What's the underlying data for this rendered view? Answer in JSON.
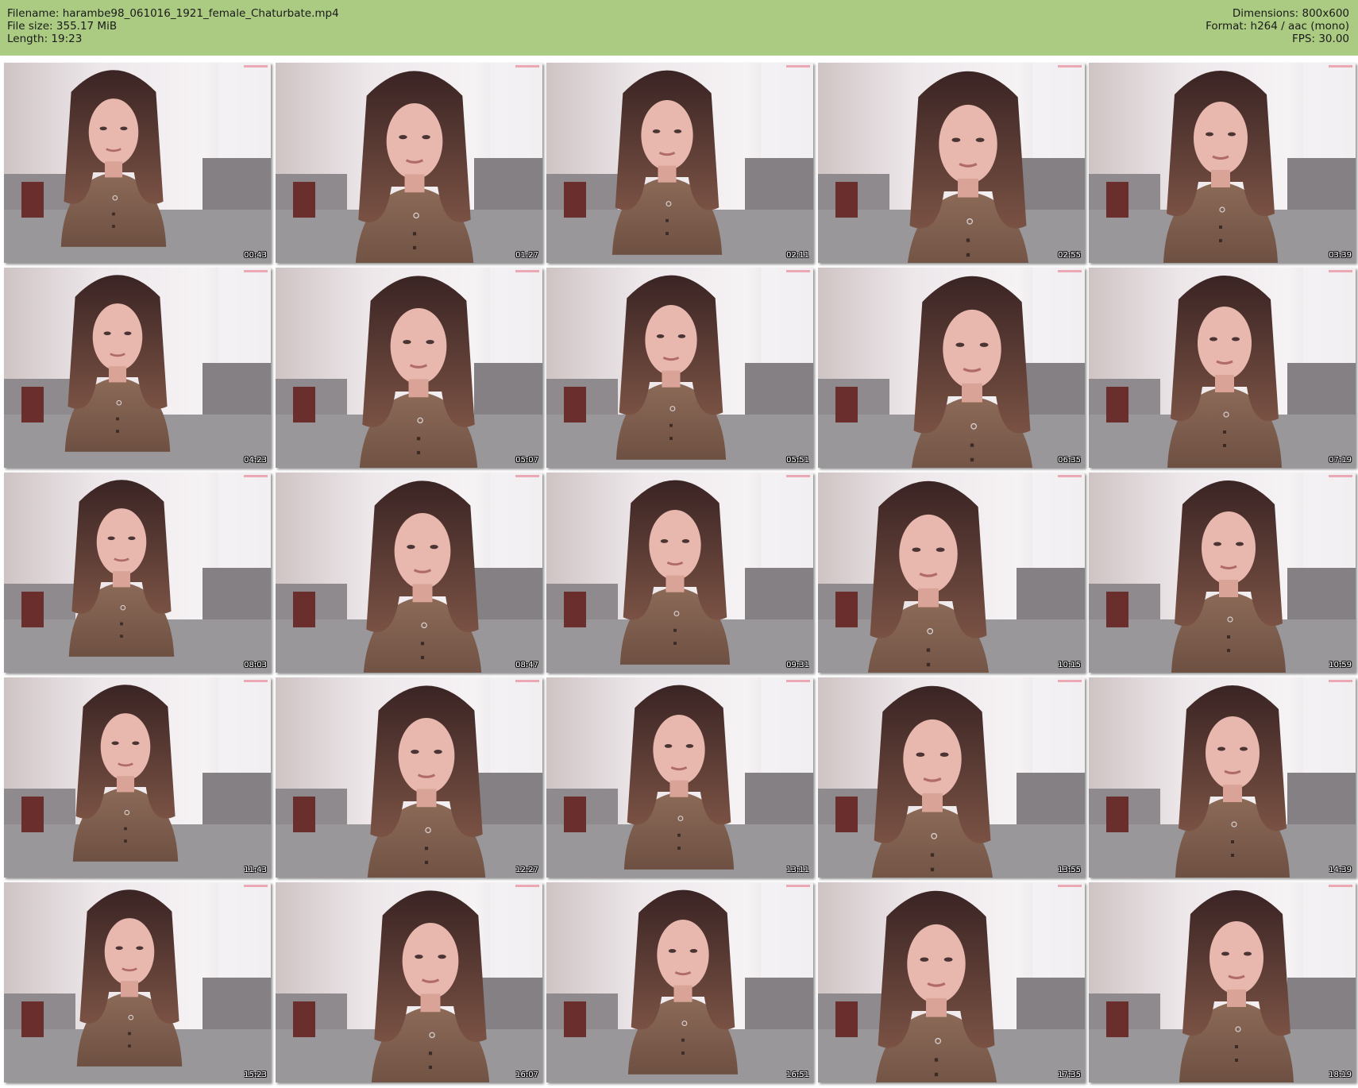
{
  "header": {
    "filename": "Filename: harambe98_061016_1921_female_Chaturbate.mp4",
    "filesize": "File size: 355.17 MiB",
    "length": "Length: 19:23",
    "dimensions": "Dimensions: 800x600",
    "format": "Format: h264 / aac (mono)",
    "fps": "FPS: 30.00"
  },
  "colors": {
    "header_bg": "#accb82",
    "page_bg": "#ffffff"
  },
  "thumbnails": [
    {
      "time": "00:43"
    },
    {
      "time": "01:27"
    },
    {
      "time": "02:11"
    },
    {
      "time": "02:55"
    },
    {
      "time": "03:39"
    },
    {
      "time": "04:23"
    },
    {
      "time": "05:07"
    },
    {
      "time": "05:51"
    },
    {
      "time": "06:35"
    },
    {
      "time": "07:19"
    },
    {
      "time": "08:03"
    },
    {
      "time": "08:47"
    },
    {
      "time": "09:31"
    },
    {
      "time": "10:15"
    },
    {
      "time": "10:59"
    },
    {
      "time": "11:43"
    },
    {
      "time": "12:27"
    },
    {
      "time": "13:11"
    },
    {
      "time": "13:55"
    },
    {
      "time": "14:39"
    },
    {
      "time": "15:23"
    },
    {
      "time": "16:07"
    },
    {
      "time": "16:51"
    },
    {
      "time": "17:35"
    },
    {
      "time": "18:19"
    }
  ]
}
